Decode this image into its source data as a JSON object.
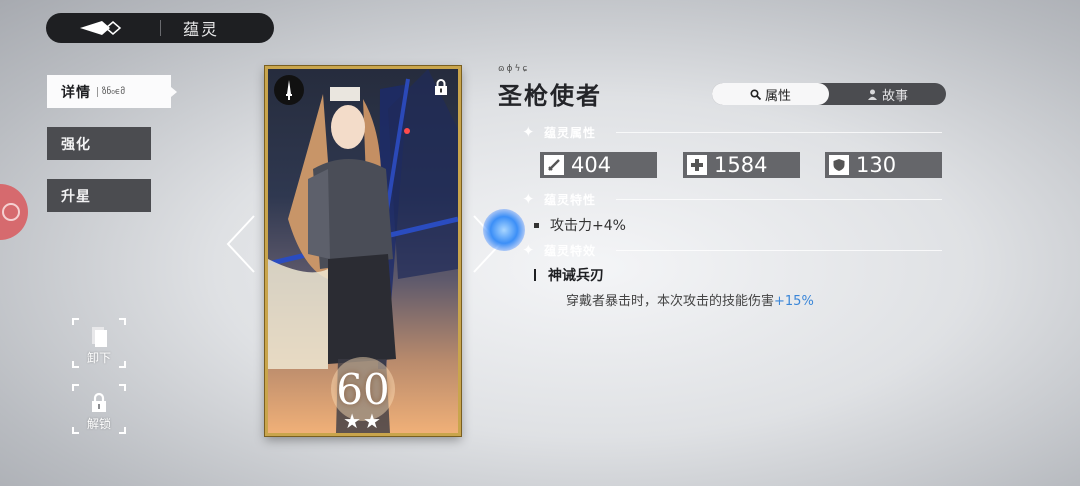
{
  "header": {
    "title": "蕴灵"
  },
  "nav": {
    "items": [
      {
        "label": "详情",
        "sub": "ზნ₀ϵმ"
      },
      {
        "label": "强化"
      },
      {
        "label": "升星"
      }
    ]
  },
  "tools": {
    "unequip_label": "卸下",
    "unlock_label": "解锁"
  },
  "card": {
    "level": "60",
    "stars": "★★"
  },
  "detail": {
    "deco": "ɷɸϟɕ",
    "name": "圣枪使者",
    "tabs": [
      {
        "label": "属性"
      },
      {
        "label": "故事"
      }
    ],
    "sections": {
      "attributes": "蕴灵属性",
      "traits": "蕴灵特性",
      "effects": "蕴灵特效"
    },
    "stats": [
      {
        "icon": "attack-icon",
        "value": "404"
      },
      {
        "icon": "health-icon",
        "value": "1584"
      },
      {
        "icon": "defense-icon",
        "value": "130"
      }
    ],
    "trait": "攻击力+4%",
    "effect": {
      "name": "神诫兵刃",
      "desc": "穿戴者暴击时，本次攻击的技能伤害",
      "highlight": "+15%"
    }
  },
  "colors": {
    "accent_blue": "#3a86d8",
    "card_border": "#c9a54c",
    "badge_red": "#d66a6e"
  }
}
